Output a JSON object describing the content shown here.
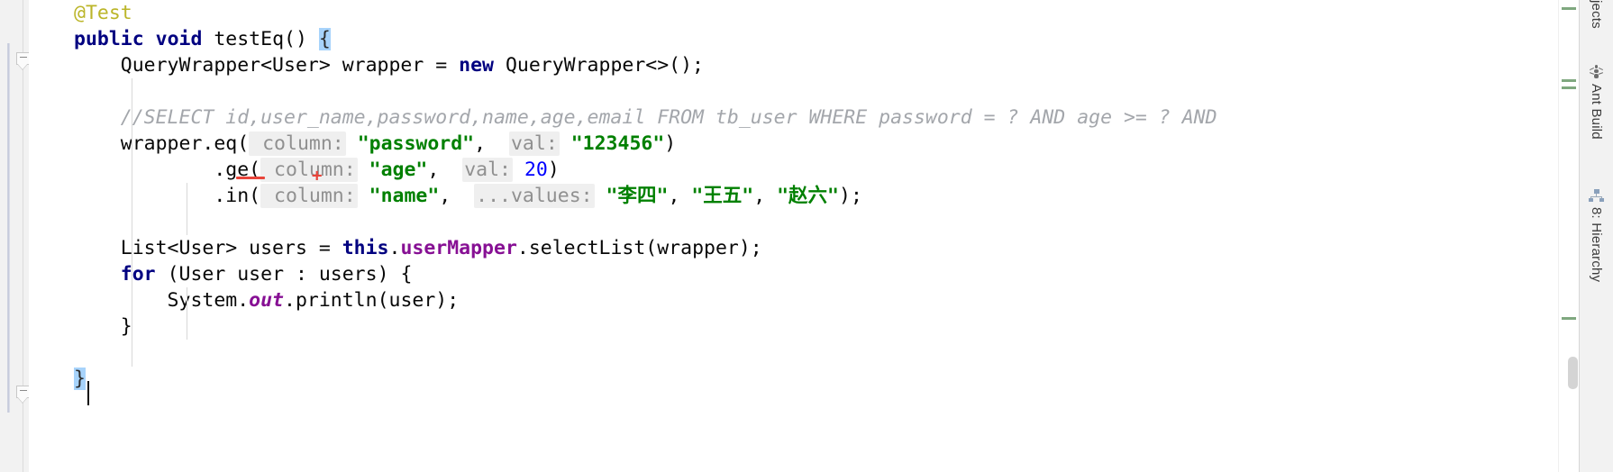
{
  "editor": {
    "language": "java",
    "theme": "IntelliJ Light",
    "colors": {
      "keyword": "#000080",
      "string": "#008000",
      "number": "#0000ff",
      "comment": "#a3a6ab",
      "annotation": "#bbb529",
      "field": "#871094",
      "param_hint_text": "#909090",
      "param_hint_bg": "#efefef",
      "current_line_bg": "#fdf6dd",
      "selection_bg": "#a7d3fb",
      "error_underline": "#e8443a",
      "vcs_marker": "#7fa87f",
      "gutter_bg": "#f2f2f2"
    },
    "lines": [
      {
        "id": "l1",
        "indent": 1,
        "segments": [
          {
            "t": "@Test",
            "c": "anno"
          }
        ]
      },
      {
        "id": "l2",
        "indent": 0,
        "segments": [
          {
            "t": "public",
            "c": "kw"
          },
          {
            "t": " ",
            "c": "plain"
          },
          {
            "t": "void",
            "c": "kw"
          },
          {
            "t": " testEq() ",
            "c": "plain"
          },
          {
            "t": "{",
            "c": "brace-hl"
          }
        ]
      },
      {
        "id": "l3",
        "indent": 0,
        "segments": [
          {
            "t": "    QueryWrapper<User> wrapper = ",
            "c": "plain"
          },
          {
            "t": "new",
            "c": "kw"
          },
          {
            "t": " QueryWrapper<>();",
            "c": "plain"
          }
        ]
      },
      {
        "id": "l4",
        "indent": 0,
        "segments": []
      },
      {
        "id": "l5",
        "indent": 0,
        "segments": [
          {
            "t": "    //SELECT id,user_name,password,name,age,email FROM tb_user WHERE password = ? AND age >= ? AND",
            "c": "cmt"
          }
        ]
      },
      {
        "id": "l6",
        "indent": 0,
        "segments": [
          {
            "t": "    wrapper.eq(",
            "c": "plain"
          },
          {
            "t": " column:",
            "c": "hint"
          },
          {
            "t": " ",
            "c": "plain"
          },
          {
            "t": "\"password\"",
            "c": "str"
          },
          {
            "t": ",  ",
            "c": "plain"
          },
          {
            "t": "val:",
            "c": "hint"
          },
          {
            "t": " ",
            "c": "plain"
          },
          {
            "t": "\"123456\"",
            "c": "str"
          },
          {
            "t": ")",
            "c": "plain"
          }
        ]
      },
      {
        "id": "l7",
        "indent": 0,
        "segments": [
          {
            "t": "            .ge(",
            "c": "plain"
          },
          {
            "t": " column:",
            "c": "hint"
          },
          {
            "t": " ",
            "c": "plain"
          },
          {
            "t": "\"age\"",
            "c": "str"
          },
          {
            "t": ",  ",
            "c": "plain"
          },
          {
            "t": "val:",
            "c": "hint"
          },
          {
            "t": " ",
            "c": "plain"
          },
          {
            "t": "20",
            "c": "num"
          },
          {
            "t": ")",
            "c": "plain"
          }
        ]
      },
      {
        "id": "l8",
        "indent": 0,
        "segments": [
          {
            "t": "            .in(",
            "c": "plain"
          },
          {
            "t": " column:",
            "c": "hint"
          },
          {
            "t": " ",
            "c": "plain"
          },
          {
            "t": "\"name\"",
            "c": "str"
          },
          {
            "t": ",  ",
            "c": "plain"
          },
          {
            "t": "...values:",
            "c": "hint"
          },
          {
            "t": " ",
            "c": "plain"
          },
          {
            "t": "\"李四\"",
            "c": "str"
          },
          {
            "t": ", ",
            "c": "plain"
          },
          {
            "t": "\"王五\"",
            "c": "str"
          },
          {
            "t": ", ",
            "c": "plain"
          },
          {
            "t": "\"赵六\"",
            "c": "str"
          },
          {
            "t": ");",
            "c": "plain"
          }
        ]
      },
      {
        "id": "l9",
        "indent": 0,
        "segments": []
      },
      {
        "id": "l10",
        "indent": 0,
        "segments": [
          {
            "t": "    List<User> users = ",
            "c": "plain"
          },
          {
            "t": "this",
            "c": "kw"
          },
          {
            "t": ".",
            "c": "plain"
          },
          {
            "t": "userMapper",
            "c": "field"
          },
          {
            "t": ".selectList(wrapper);",
            "c": "plain"
          }
        ]
      },
      {
        "id": "l11",
        "indent": 0,
        "segments": [
          {
            "t": "    ",
            "c": "plain"
          },
          {
            "t": "for",
            "c": "kw"
          },
          {
            "t": " (User user : users) {",
            "c": "plain"
          }
        ]
      },
      {
        "id": "l12",
        "indent": 0,
        "segments": [
          {
            "t": "        System.",
            "c": "plain"
          },
          {
            "t": "out",
            "c": "sfield"
          },
          {
            "t": ".println(user);",
            "c": "plain"
          }
        ]
      },
      {
        "id": "l13",
        "indent": 0,
        "segments": [
          {
            "t": "    }",
            "c": "plain"
          }
        ]
      },
      {
        "id": "l14",
        "indent": 0,
        "segments": []
      },
      {
        "id": "l15",
        "indent": 0,
        "segments": [
          {
            "t": "}",
            "c": "brace-hl"
          }
        ],
        "current": true
      }
    ]
  },
  "gutter": {
    "fold_markers": [
      {
        "name": "fold-collapse-method",
        "state": "expanded",
        "glyph": "minus"
      },
      {
        "name": "fold-collapse-class-end",
        "state": "expanded",
        "glyph": "minus"
      }
    ]
  },
  "marker_bar": {
    "vcs_changes": [
      {
        "label": "modified",
        "color": "#7fa87f"
      },
      {
        "label": "modified",
        "color": "#7fa87f"
      },
      {
        "label": "modified",
        "color": "#7fa87f"
      },
      {
        "label": "modified",
        "color": "#7fa87f"
      }
    ]
  },
  "tool_window_stripe": {
    "buttons": [
      {
        "id": "projects",
        "label": "jects",
        "full_label": "Projects",
        "icon": "project-icon"
      },
      {
        "id": "ant-build",
        "label": "Ant Build",
        "icon": "ant-icon"
      },
      {
        "id": "hierarchy",
        "label": "8: Hierarchy",
        "icon": "hierarchy-icon"
      }
    ]
  },
  "inspection": {
    "error_token": "eq",
    "has_error_underline": true,
    "caret_marker": "+"
  }
}
